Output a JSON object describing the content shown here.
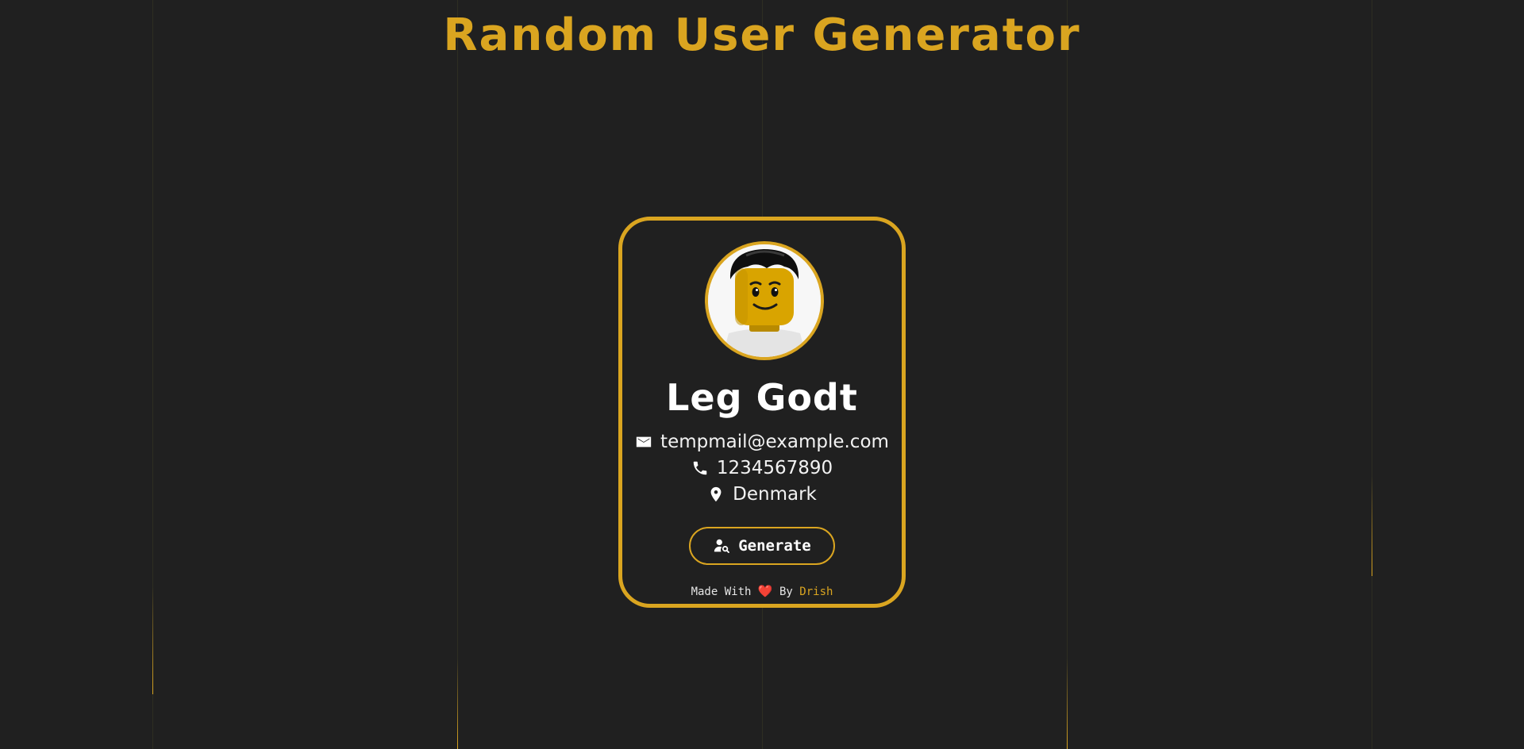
{
  "page": {
    "title": "Random User Generator"
  },
  "user": {
    "name": "Leg Godt",
    "email": "tempmail@example.com",
    "phone": "1234567890",
    "location": "Denmark"
  },
  "actions": {
    "generate_label": "Generate"
  },
  "footer": {
    "made_with": "Made With",
    "heart": "❤️",
    "by": "By",
    "author": "Drish"
  },
  "icons": {
    "email": "envelope-icon",
    "phone": "phone-icon",
    "location": "map-pin-icon",
    "generate": "user-search-icon"
  },
  "colors": {
    "background": "#202020",
    "accent": "#daa520",
    "text": "#ffffff",
    "heart": "#e33a3a"
  }
}
